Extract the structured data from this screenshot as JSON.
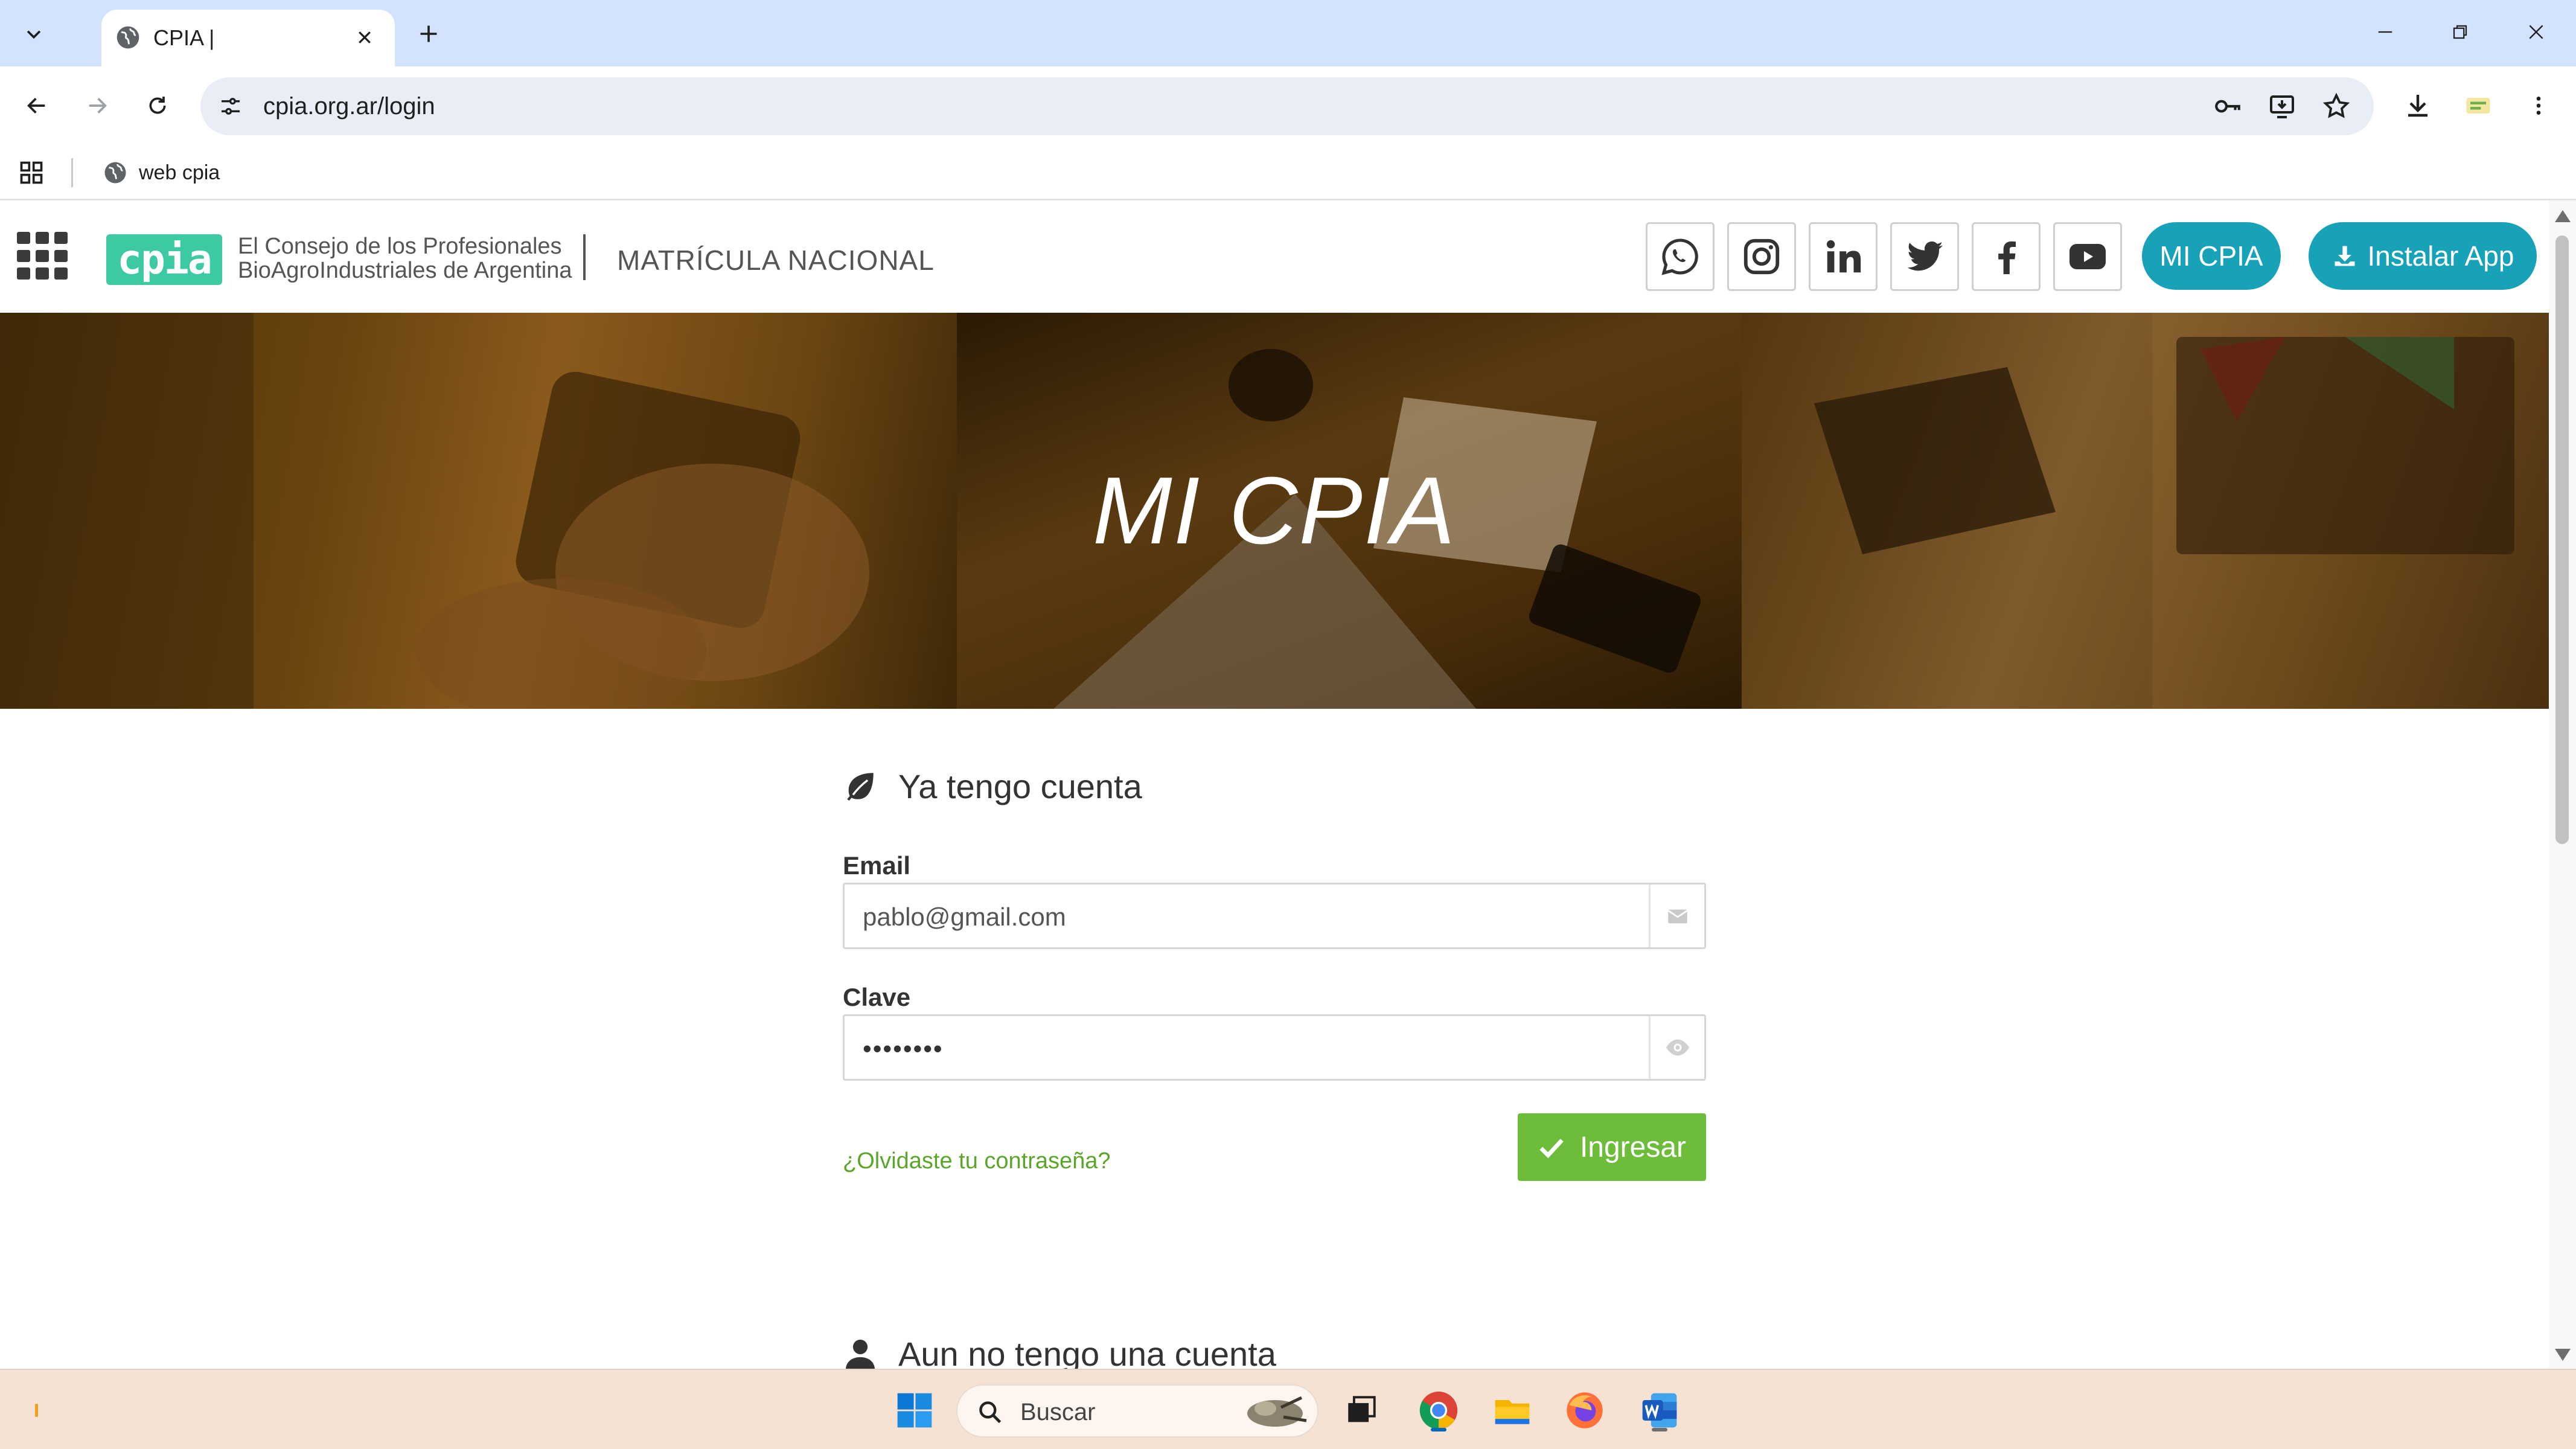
{
  "browser": {
    "tab_title": "CPIA |",
    "url": "cpia.org.ar/login",
    "bookmark": "web cpia"
  },
  "header": {
    "logo_mark": "cpia",
    "logo_line1": "El Consejo de los Profesionales",
    "logo_line2": "BioAgroIndustriales de Argentina",
    "matricula": "MATRÍCULA NACIONAL",
    "social_icons": [
      "whatsapp-icon",
      "instagram-icon",
      "linkedin-icon",
      "twitter-icon",
      "facebook-icon",
      "youtube-icon"
    ],
    "mi_cpia_button": "MI CPIA",
    "install_button": "Instalar App"
  },
  "hero": {
    "title": "MI CPIA"
  },
  "login": {
    "heading": "Ya tengo cuenta",
    "email_label": "Email",
    "email_value": "pablo@gmail.com",
    "password_label": "Clave",
    "password_value": "••••••••",
    "forgot_link": "¿Olvidaste tu contraseña?",
    "submit_label": "Ingresar"
  },
  "signup": {
    "heading": "Aun no tengo una cuenta"
  },
  "taskbar": {
    "search_placeholder": "Buscar"
  },
  "colors": {
    "accent_teal": "#17a2b8",
    "accent_green": "#6dbd3a",
    "link_green": "#5aa52a",
    "brand_logo": "#3dc9a4"
  }
}
